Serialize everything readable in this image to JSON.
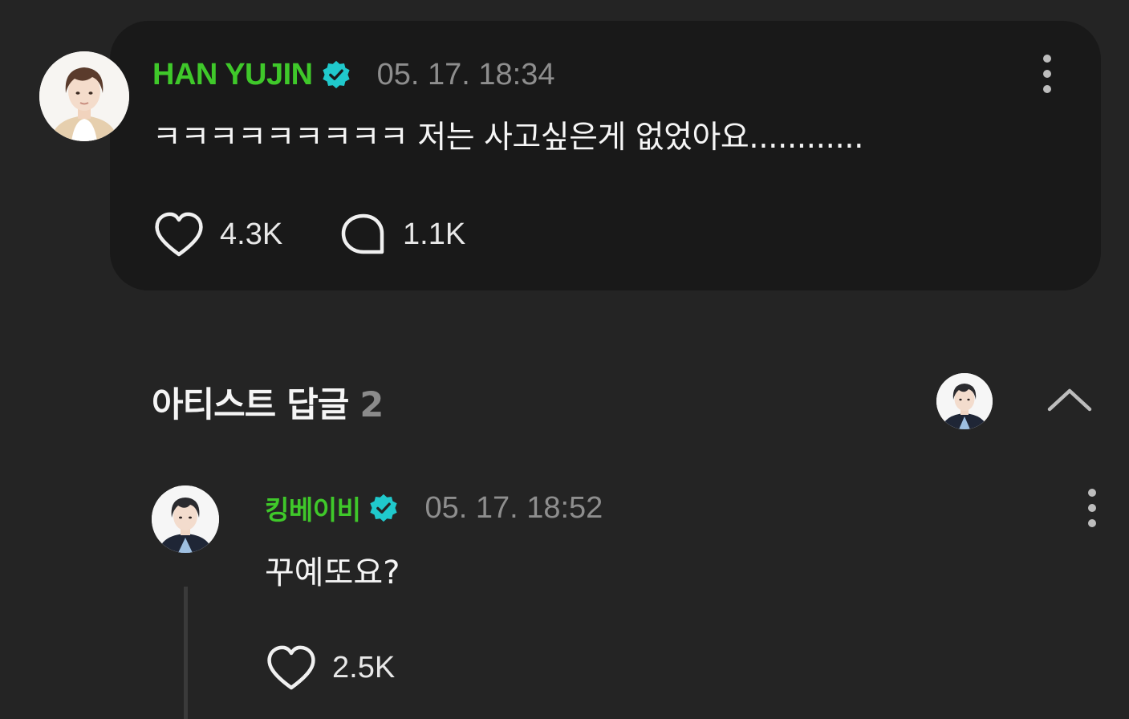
{
  "comment": {
    "author": "HAN YUJIN",
    "verified": true,
    "timestamp": "05. 17. 18:34",
    "text": "ㅋㅋㅋㅋㅋㅋㅋㅋㅋ 저는 사고싶은게 없었아요............",
    "likes": "4.3K",
    "replies": "1.1K"
  },
  "artist_replies": {
    "title": "아티스트 답글",
    "count": "2",
    "items": [
      {
        "author": "킹베이비",
        "verified": true,
        "timestamp": "05. 17. 18:52",
        "text": "꾸예또요?",
        "likes": "2.5K"
      }
    ]
  },
  "icons": {
    "verified": "verified-badge-icon",
    "like": "heart-icon",
    "reply": "speech-bubble-icon",
    "more": "more-vertical-icon",
    "collapse": "chevron-up-icon"
  },
  "colors": {
    "background": "#242424",
    "card": "#191919",
    "author_name": "#3fc82a",
    "verified_badge": "#20c9cc",
    "timestamp": "#8e8e8e",
    "text": "#f5f5f5"
  }
}
